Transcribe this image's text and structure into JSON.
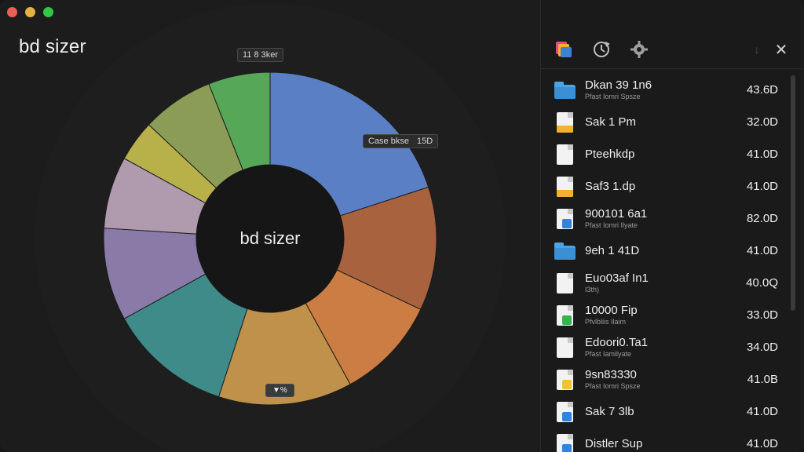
{
  "window": {
    "app_title": "bd sizer"
  },
  "chart": {
    "center_label": "bd sizer",
    "tag_top": "11 8 3ker",
    "tag_right_left": "Case bkse",
    "tag_right_right": "15D",
    "tag_bottom": "▼%",
    "colors": {
      "blue": "#5b7fc4",
      "orange_dark": "#a8623e",
      "orange": "#cc7d44",
      "gold": "#c0914a",
      "teal": "#3f8b8a",
      "lavender": "#8a7aa8",
      "rose": "#b09aae",
      "yellow": "#b8b14a",
      "green": "#57a758",
      "olive": "#8a9c55"
    }
  },
  "chart_data": {
    "type": "pie",
    "categories": [
      "",
      "",
      "",
      "",
      "",
      "",
      "",
      "",
      "",
      ""
    ],
    "values": [
      20,
      12,
      10,
      13,
      12,
      9,
      7,
      4,
      7,
      6
    ],
    "title": "bd sizer"
  },
  "toolbar": {
    "close_symbol": "✕",
    "chevron_symbol": "↓"
  },
  "files": [
    {
      "name": "Dkan 39 1n6",
      "sub": "Pfast Iomri Spsze",
      "size": "43.6D",
      "icon": "folder"
    },
    {
      "name": "Sak 1 Pm",
      "sub": "",
      "size": "32.0D",
      "icon": "doc-yellow"
    },
    {
      "name": "Pteehkdp",
      "sub": "",
      "size": "41.0D",
      "icon": "doc"
    },
    {
      "name": "Saf3 1.dp",
      "sub": "",
      "size": "41.0D",
      "icon": "doc-yellow"
    },
    {
      "name": "900101 6a1",
      "sub": "Pfast Iomri Ilyate",
      "size": "82.0D",
      "icon": "doc-blue"
    },
    {
      "name": "9eh 1 41D",
      "sub": "",
      "size": "41.0D",
      "icon": "folder"
    },
    {
      "name": "Euo03af In1",
      "sub": "I3th)",
      "size": "40.0Q",
      "icon": "doc"
    },
    {
      "name": "10000 Fip",
      "sub": "Pfvlbliis Ilaim",
      "size": "33.0D",
      "icon": "doc-green"
    },
    {
      "name": "Edoori0.Ta1",
      "sub": "Pfast Iamilyate",
      "size": "34.0D",
      "icon": "doc"
    },
    {
      "name": "9sn83330",
      "sub": "Pfast Iomri Spsze",
      "size": "41.0B",
      "icon": "doc-yellowbadge"
    },
    {
      "name": "Sak 7 3lb",
      "sub": "",
      "size": "41.0D",
      "icon": "doc-blue"
    },
    {
      "name": "Distler Sup",
      "sub": "",
      "size": "41.0D",
      "icon": "doc-blue"
    }
  ]
}
